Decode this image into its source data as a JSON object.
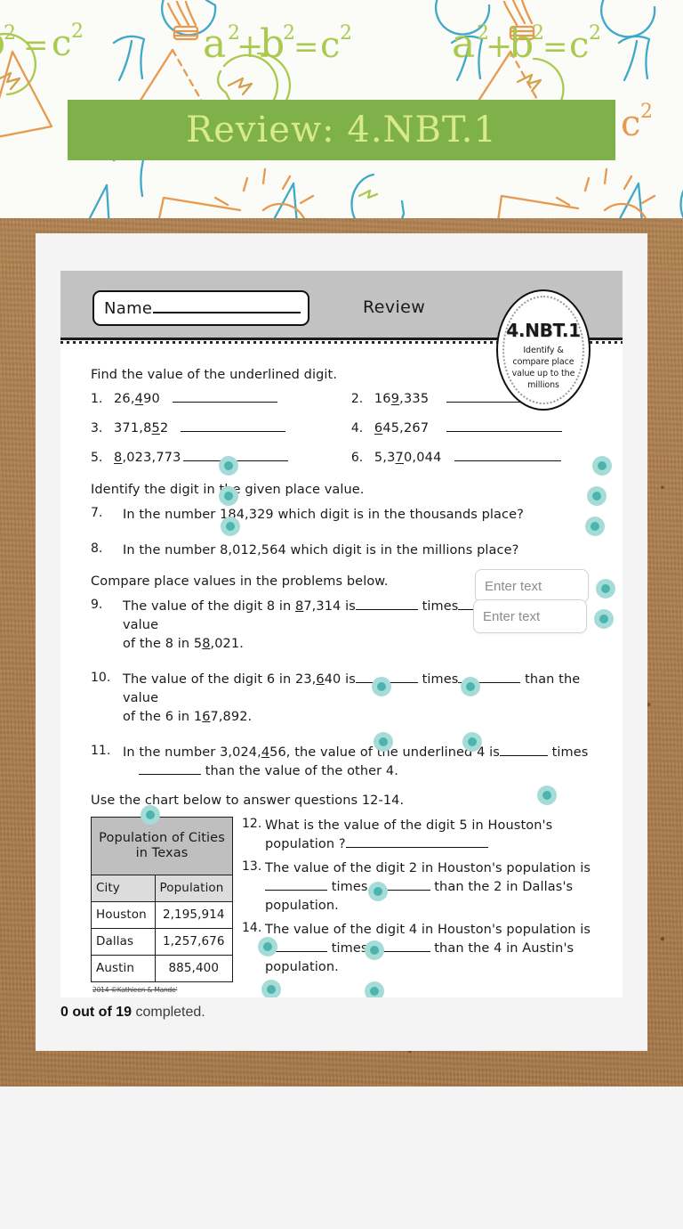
{
  "banner": {
    "title": "Review: 4.NBT.1",
    "bar_color": "#7fb14b",
    "text_color": "#d8ea8a"
  },
  "worksheet": {
    "name_label": "Name",
    "review_label": "Review",
    "badge": {
      "code": "4.NBT.1",
      "description": "Identify & compare place value up to the millions"
    },
    "section1": {
      "heading": "Find the value of the underlined digit.",
      "items": [
        {
          "num": "1.",
          "pre": "26,",
          "mid": "4",
          "post": "90"
        },
        {
          "num": "2.",
          "pre": "16",
          "mid": "9",
          "post": ",335"
        },
        {
          "num": "3.",
          "pre": "371,8",
          "mid": "5",
          "post": "2"
        },
        {
          "num": "4.",
          "pre": "",
          "mid": "6",
          "post": "45,267"
        },
        {
          "num": "5.",
          "pre": "",
          "mid": "8",
          "post": ",023,773"
        },
        {
          "num": "6.",
          "pre": "5,3",
          "mid": "7",
          "post": "0,044"
        }
      ]
    },
    "section2": {
      "heading": "Identify the digit in the given place value.",
      "items": [
        {
          "num": "7.",
          "text": "In the number 184,329 which digit is in the thousands place?",
          "placeholder": "Enter text"
        },
        {
          "num": "8.",
          "text": "In the number 8,012,564 which digit is in the millions place?",
          "placeholder": "Enter text"
        }
      ]
    },
    "section3": {
      "heading": "Compare place values in the problems below.",
      "q9": {
        "num": "9.",
        "p1": "The value of the digit 8 in ",
        "u1": "8",
        "p2": "7,314 is",
        "p3": "times",
        "p4": "than the value",
        "p5": "of the 8 in 5",
        "u2": "8",
        "p6": ",021."
      },
      "q10": {
        "num": "10.",
        "p1": "The value of the digit 6 in 23,",
        "u1": "6",
        "p2": "40 is",
        "p3": "times",
        "p4": "than the value",
        "p5": "of the 6 in 1",
        "u2": "6",
        "p6": "7,892."
      },
      "q11": {
        "num": "11.",
        "p1": "In the number 3,024,",
        "u1": "4",
        "p2": "56, the value of the underlined 4 is",
        "p3": "times",
        "p4": "than the value of the other 4."
      }
    },
    "section4": {
      "heading": "Use the chart below to answer questions 12-14.",
      "table": {
        "title": "Population of Cities in Texas",
        "columns": [
          "City",
          "Population"
        ],
        "rows": [
          [
            "Houston",
            "2,195,914"
          ],
          [
            "Dallas",
            "1,257,676"
          ],
          [
            "Austin",
            "885,400"
          ]
        ]
      },
      "credit": "2014 ©Kathleen & Mande'",
      "q12": {
        "num": "12.",
        "l1": "What is the value of the digit 5 in Houston's",
        "l2": "population ?"
      },
      "q13": {
        "num": "13.",
        "l1": "The value of the digit 2 in Houston's population is",
        "mid": "times",
        "tail": "than the 2 in Dallas's population."
      },
      "q14": {
        "num": "14.",
        "l1": "The value of the digit 4 in Houston's population is",
        "mid": "times",
        "tail": "than the 4 in Austin's population."
      }
    }
  },
  "status": {
    "count": "0 out of 19",
    "suffix": " completed."
  }
}
